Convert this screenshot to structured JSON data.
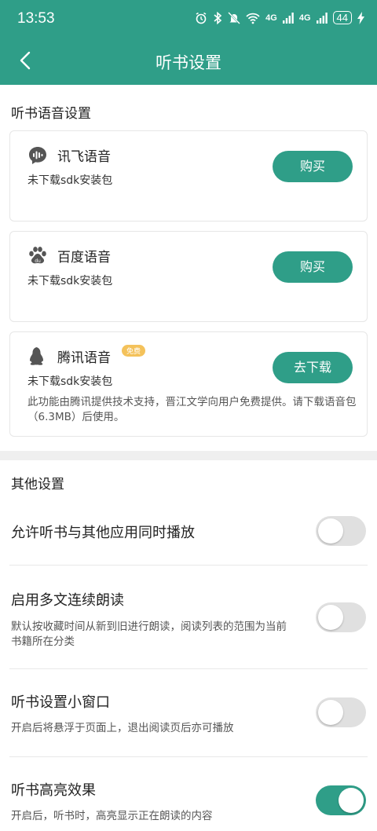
{
  "status_bar": {
    "time": "13:53",
    "network_labels": [
      "4G",
      "4G"
    ],
    "battery": "44",
    "icons": [
      "alarm-icon",
      "bluetooth-icon",
      "mute-icon",
      "wifi-icon",
      "signal-icon",
      "signal-icon",
      "battery-icon",
      "charging-icon"
    ]
  },
  "header": {
    "title": "听书设置",
    "back_icon": "chevron-left-icon",
    "bg_color": "#2f9e88"
  },
  "voice_section": {
    "title": "听书语音设置",
    "engines": [
      {
        "name": "讯飞语音",
        "status": "未下载sdk安装包",
        "button": "购买",
        "icon": "iflytek-voice-icon"
      },
      {
        "name": "百度语音",
        "status": "未下载sdk安装包",
        "button": "购买",
        "icon": "baidu-paw-icon"
      },
      {
        "name": "腾讯语音",
        "badge": "免费",
        "status": "未下载sdk安装包",
        "button": "去下载",
        "icon": "qq-penguin-icon",
        "description": "此功能由腾讯提供技术支持，晋江文学向用户免费提供。请下载语音包（6.3MB）后使用。"
      }
    ]
  },
  "other_section": {
    "title": "其他设置",
    "options": [
      {
        "title": "允许听书与其他应用同时播放",
        "description": "",
        "enabled": false
      },
      {
        "title": "启用多文连续朗读",
        "description": "默认按收藏时间从新到旧进行朗读，阅读列表的范围为当前书籍所在分类",
        "enabled": false
      },
      {
        "title": "听书设置小窗口",
        "description": "开启后将悬浮于页面上，退出阅读页后亦可播放",
        "enabled": false
      },
      {
        "title": "听书高亮效果",
        "description": "开启后，听书时，高亮显示正在朗读的内容",
        "enabled": true
      }
    ]
  },
  "colors": {
    "accent": "#2f9e88",
    "toggle_off": "#e0e0e0",
    "badge": "#f4c25b"
  }
}
